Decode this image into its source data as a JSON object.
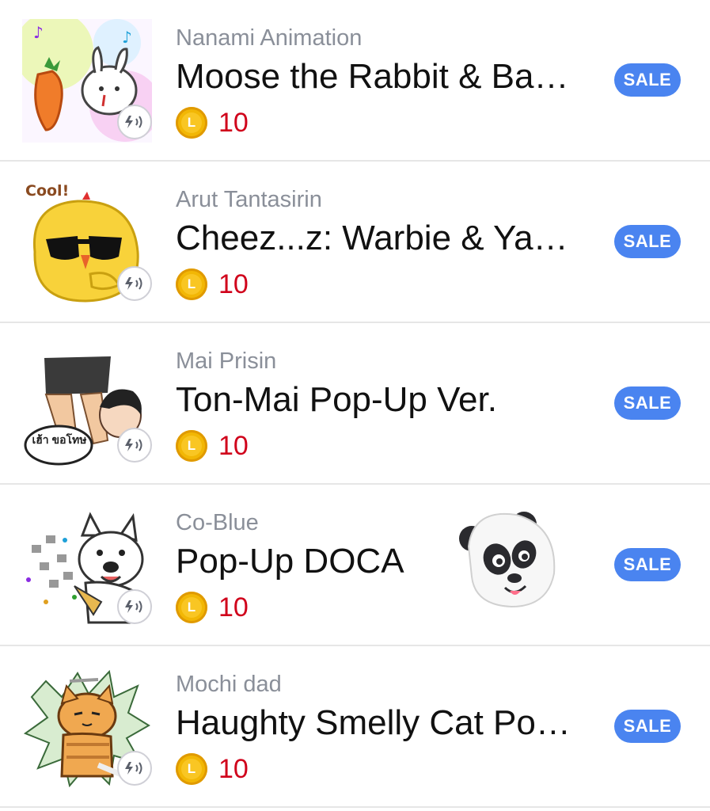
{
  "items": [
    {
      "author": "Nanami Animation",
      "title": "Moose the Rabbit & Ba…",
      "coin_letter": "L",
      "price": "10",
      "badge": "SALE",
      "thumbnail": "rabbit-carrot-sticker-icon",
      "sound_icon": "pop-up-sound-icon"
    },
    {
      "author": "Arut Tantasirin",
      "title": "Cheez...z: Warbie & Ya…",
      "coin_letter": "L",
      "price": "10",
      "badge": "SALE",
      "thumbnail_text": "Cool!",
      "thumbnail": "yellow-chick-sunglasses-sticker-icon",
      "sound_icon": "pop-up-sound-icon"
    },
    {
      "author": "Mai Prisin",
      "title": "Ton-Mai Pop-Up Ver.",
      "coin_letter": "L",
      "price": "10",
      "badge": "SALE",
      "thumbnail_text": "เฮ้า ขอโทษ",
      "thumbnail": "boy-speech-bubble-sticker-icon",
      "sound_icon": "pop-up-sound-icon"
    },
    {
      "author": "Co-Blue",
      "title": "Pop-Up DOCA",
      "coin_letter": "L",
      "price": "10",
      "badge": "SALE",
      "thumbnail": "bulldog-party-sticker-icon",
      "sound_icon": "pop-up-sound-icon"
    },
    {
      "author": "Mochi dad",
      "title": "Haughty Smelly Cat Po…",
      "coin_letter": "L",
      "price": "10",
      "badge": "SALE",
      "thumbnail": "orange-cat-sticker-icon",
      "sound_icon": "pop-up-sound-icon"
    }
  ],
  "overlay": {
    "icon": "panda-face-icon"
  },
  "colors": {
    "sale_badge": "#4a84f0",
    "price": "#d0021b",
    "coin": "#f2b705",
    "author": "#8a8f99",
    "divider": "#e6e6e6"
  }
}
